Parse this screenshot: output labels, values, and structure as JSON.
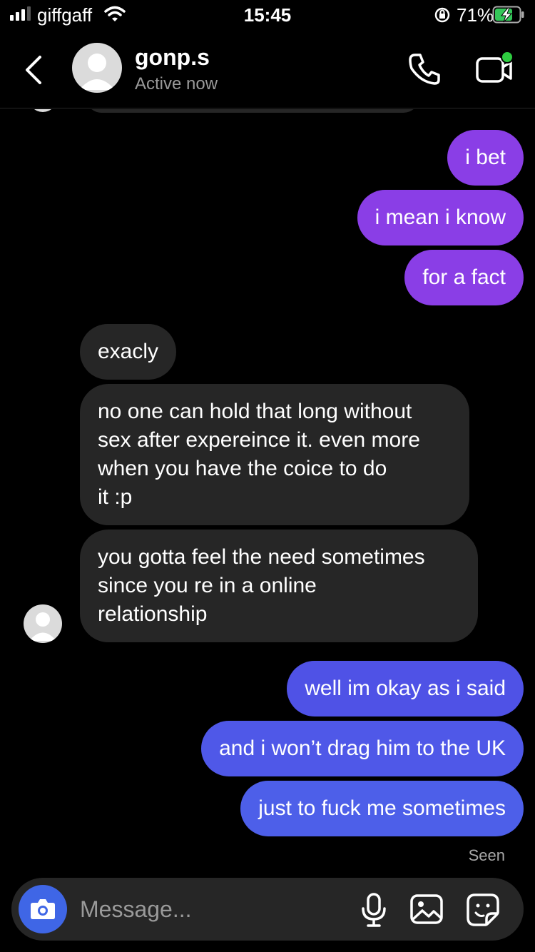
{
  "status_bar": {
    "carrier": "giffgaff",
    "time": "15:45",
    "battery_percent": "71%",
    "signal_bars": 3
  },
  "header": {
    "username": "gonp.s",
    "presence": "Active now",
    "back_icon": "chevron-left-icon",
    "call_icon": "phone-icon",
    "video_icon": "video-camera-icon",
    "online_dot_color": "#2ecc40"
  },
  "messages": [
    {
      "side": "out",
      "text": "i bet",
      "color": "#8a3ee6"
    },
    {
      "side": "out",
      "text": "i mean i know",
      "color": "#8a3ee6"
    },
    {
      "side": "out",
      "text": "for a fact",
      "color": "#8a3ee6"
    },
    {
      "side": "in",
      "text": "exacly"
    },
    {
      "side": "in",
      "lines": [
        "no one can hold that long without",
        "sex after expereince it. even more",
        "when you have the coice to do",
        "it :p"
      ]
    },
    {
      "side": "in",
      "lines": [
        "you gotta feel the need sometimes",
        "since you re in a online",
        "relationship"
      ]
    },
    {
      "side": "out",
      "text": "well im okay as i said",
      "color": "#4f52e6"
    },
    {
      "side": "out",
      "text": "and i won’t drag him to the UK",
      "color": "#4f58e8"
    },
    {
      "side": "out",
      "text": "just to fuck me sometimes",
      "color": "#4d5fe9"
    }
  ],
  "seen_label": "Seen",
  "composer": {
    "placeholder": "Message...",
    "camera_icon": "camera-icon",
    "mic_icon": "microphone-icon",
    "gallery_icon": "image-icon",
    "sticker_icon": "sticker-icon",
    "camera_button_color": "#3f66e6"
  }
}
